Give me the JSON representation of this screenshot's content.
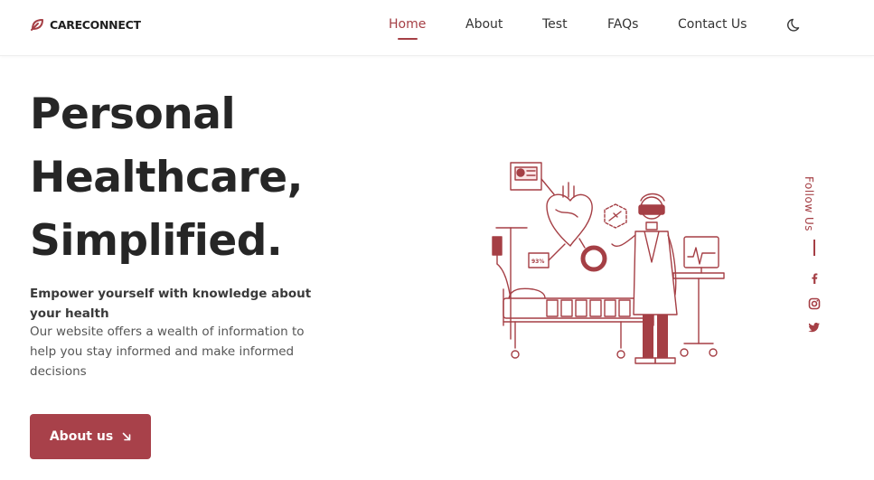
{
  "brand": {
    "name": "CARECONNECT",
    "accent": "#a53f45"
  },
  "nav": {
    "items": [
      {
        "label": "Home",
        "active": true
      },
      {
        "label": "About",
        "active": false
      },
      {
        "label": "Test",
        "active": false
      },
      {
        "label": "FAQs",
        "active": false
      },
      {
        "label": "Contact Us",
        "active": false
      }
    ],
    "theme_toggle_icon": "moon-icon"
  },
  "hero": {
    "title_line1": "Personal",
    "title_line2": "Healthcare,",
    "title_line3": "Simplified.",
    "subtitle": "Empower yourself with knowledge about your health",
    "description": "Our website offers a wealth of information to help you stay informed and make informed decisions",
    "cta_label": "About us",
    "cta_icon": "arrow-down-right-icon"
  },
  "illustration": {
    "monitor_reading": "93%"
  },
  "follow": {
    "label": "Follow Us",
    "icons": [
      "facebook-icon",
      "instagram-icon",
      "twitter-icon"
    ]
  }
}
